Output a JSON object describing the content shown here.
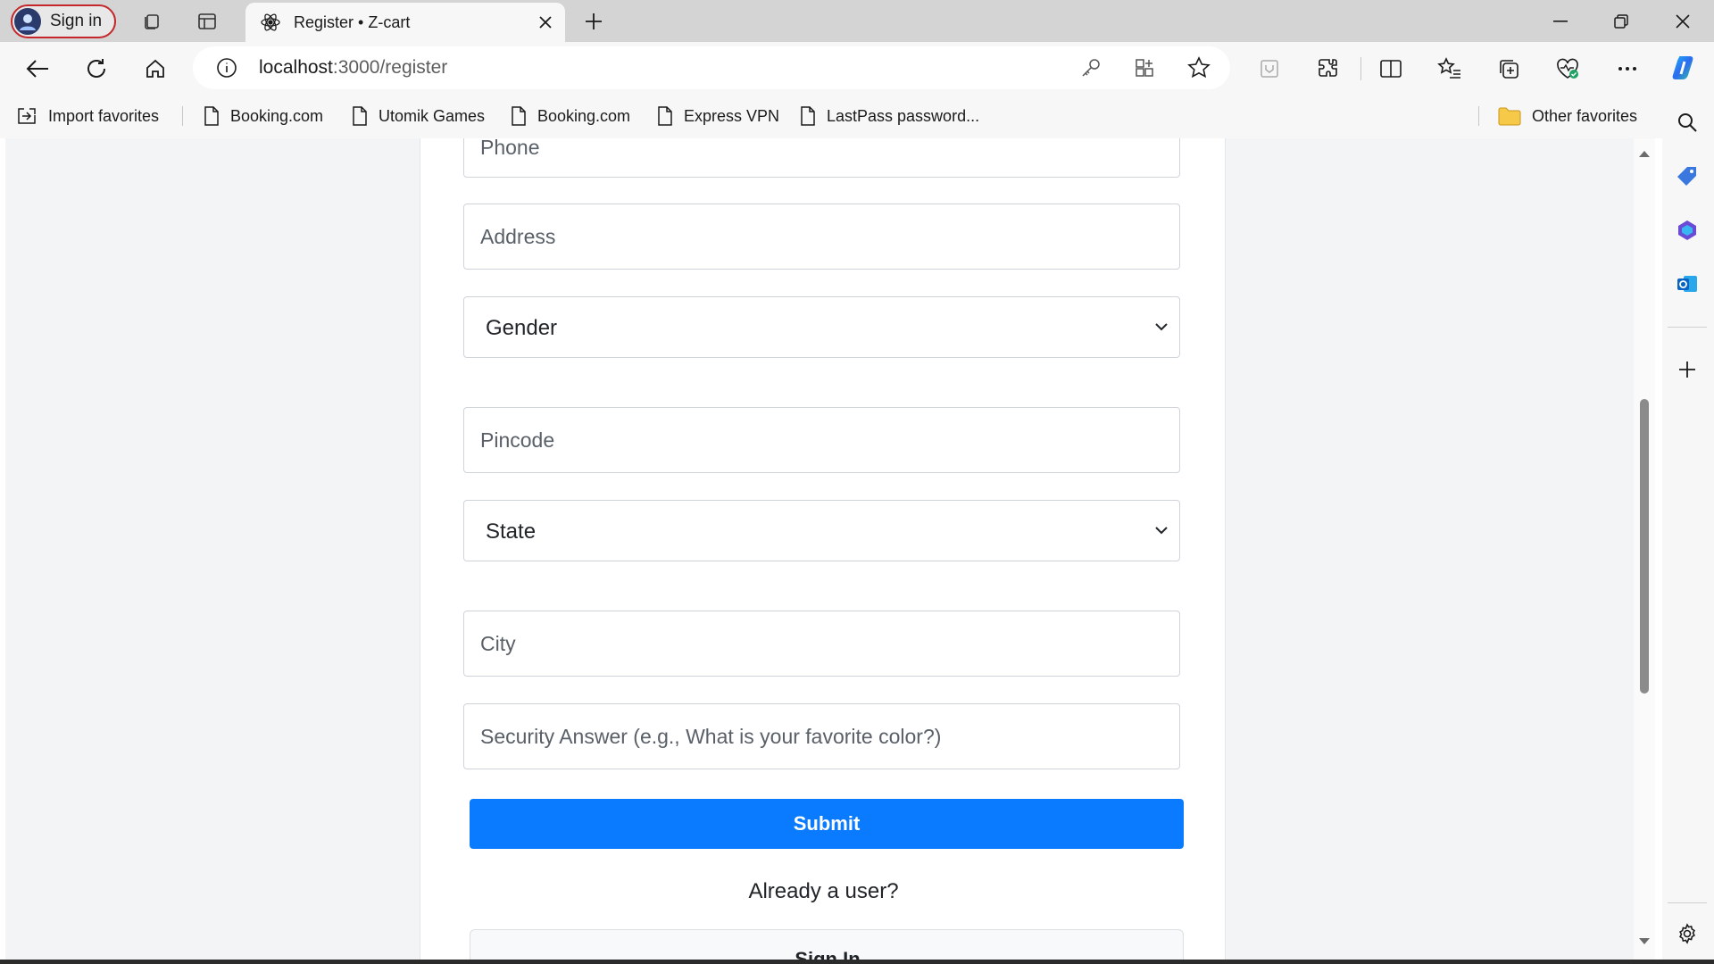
{
  "browser": {
    "signin_label": "Sign in",
    "tab_title": "Register • Z-cart",
    "url_host": "localhost",
    "url_path": ":3000/register",
    "bookmarks": [
      {
        "label": "Import favorites",
        "icon": "import-icon"
      },
      {
        "label": "Booking.com",
        "icon": "page-icon"
      },
      {
        "label": "Utomik Games",
        "icon": "page-icon"
      },
      {
        "label": "Booking.com",
        "icon": "page-icon"
      },
      {
        "label": "Express VPN",
        "icon": "page-icon"
      },
      {
        "label": "LastPass password...",
        "icon": "page-icon"
      }
    ],
    "other_favorites": "Other favorites",
    "colors": {
      "accent": "#0a7bff",
      "signin_border": "#c4272c"
    }
  },
  "form": {
    "phone_placeholder": "Phone",
    "address_placeholder": "Address",
    "gender_selected": "Gender",
    "pincode_placeholder": "Pincode",
    "state_selected": "State",
    "city_placeholder": "City",
    "security_placeholder": "Security Answer (e.g., What is your favorite color?)",
    "submit_label": "Submit",
    "already_user_text": "Already a user?",
    "signin_button_label": "Sign In"
  }
}
